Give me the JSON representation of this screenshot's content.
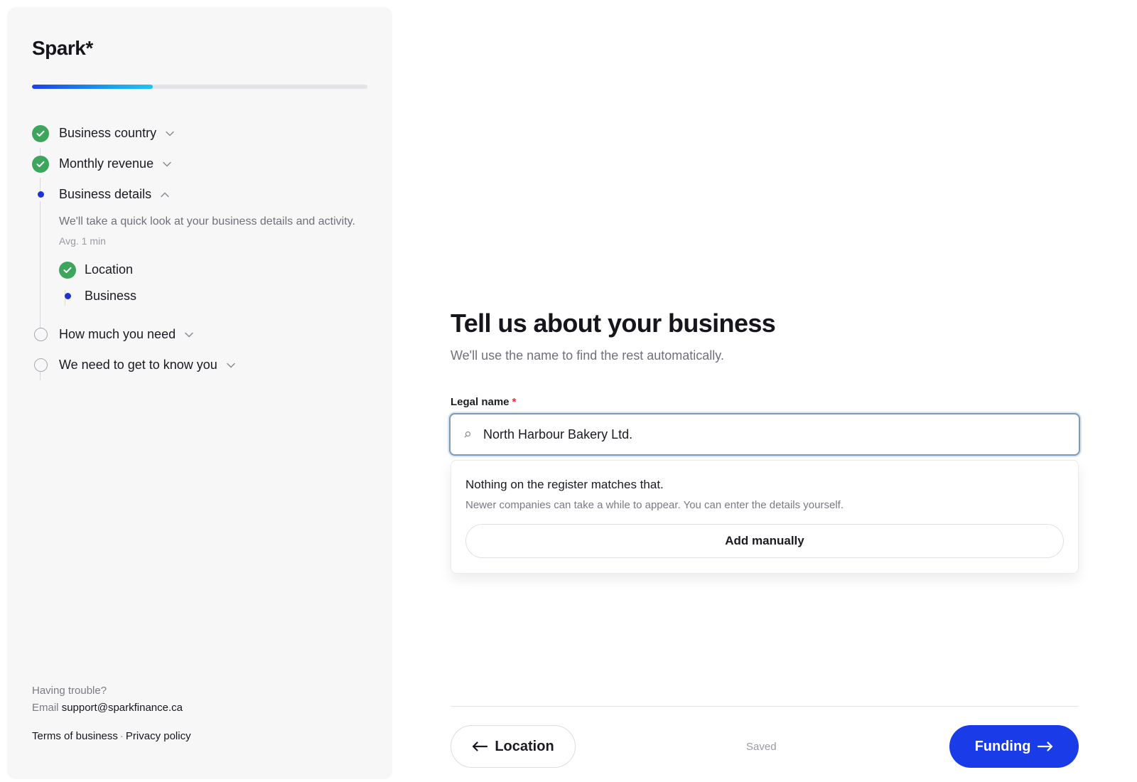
{
  "brand": {
    "name": "Spark*"
  },
  "progress": {
    "fraction": 0.36
  },
  "sidebar": {
    "steps": [
      {
        "label": "Business country",
        "status": "complete",
        "expanded": false
      },
      {
        "label": "Monthly revenue",
        "status": "complete",
        "expanded": false
      },
      {
        "label": "Business details",
        "status": "current",
        "expanded": true,
        "description": "We'll take a quick look at your business details and activity.",
        "time": "Avg. 1 min",
        "substeps": [
          {
            "label": "Location",
            "status": "complete"
          },
          {
            "label": "Business",
            "status": "current"
          }
        ]
      },
      {
        "label": "How much you need",
        "status": "upcoming",
        "expanded": false
      },
      {
        "label": "We need to get to know you",
        "status": "upcoming",
        "expanded": false
      }
    ],
    "help": {
      "question": "Having trouble?",
      "email_prefix": "Email",
      "email": "support@sparkfinance.ca"
    },
    "legal": {
      "terms": "Terms of business",
      "separator": "·",
      "privacy": "Privacy policy"
    }
  },
  "main": {
    "title": "Tell us about your business",
    "subtitle": "We'll use the name to find the rest automatically.",
    "field": {
      "label": "Legal name",
      "required_mark": "*",
      "value": "North Harbour Bakery Ltd."
    },
    "dropdown": {
      "title": "Nothing on the register matches that.",
      "subtitle": "Newer companies can take a while to appear. You can enter the details yourself.",
      "button": "Add manually"
    },
    "footer": {
      "back_label": "Location",
      "status": "Saved",
      "next_label": "Funding"
    }
  },
  "colors": {
    "accent": "#1a3be8",
    "complete": "#3ea65c",
    "current_dot": "#1c32d6"
  }
}
